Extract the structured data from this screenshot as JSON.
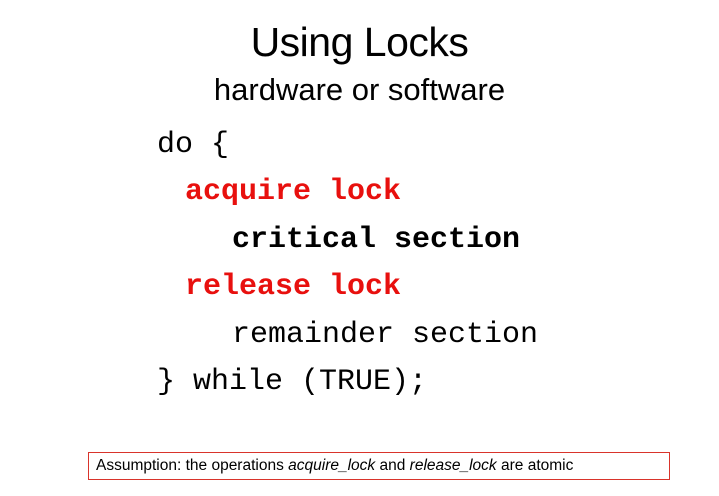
{
  "slide": {
    "title": "Using Locks",
    "subtitle": "hardware or software",
    "code": {
      "line1": "do {",
      "line2": "acquire lock",
      "line3": "critical section",
      "line4": "release lock",
      "line5": "remainder section",
      "line6": "} while (TRUE);"
    },
    "note": {
      "prefix": "Assumption: the operations ",
      "term1": "acquire_lock",
      "middle": " and ",
      "term2": "release_lock",
      "suffix": " are atomic"
    },
    "colors": {
      "keyword_red": "#e8100e",
      "note_border": "#d9342b"
    }
  }
}
